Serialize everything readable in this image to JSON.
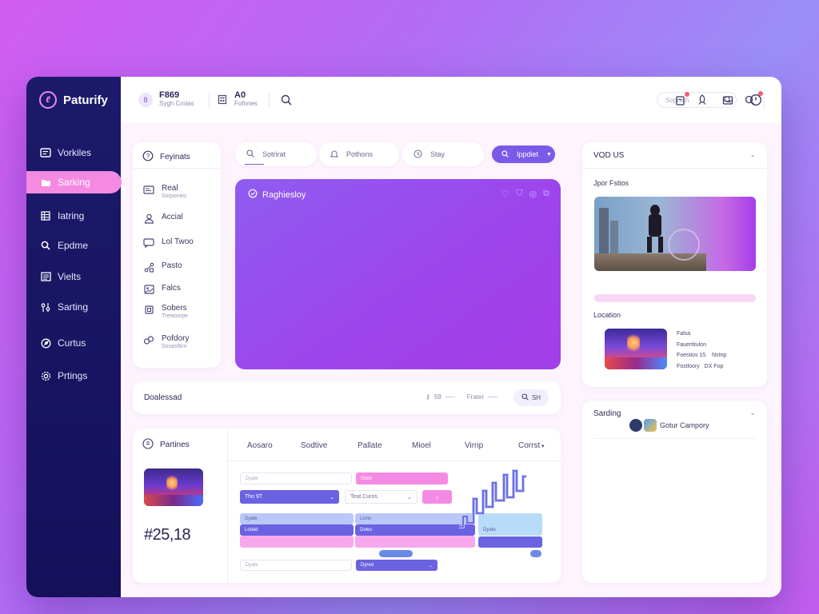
{
  "app": {
    "name": "Paturify"
  },
  "sidebar": {
    "items": [
      {
        "label": "Vorkiles",
        "icon": "dashboard-icon"
      },
      {
        "label": "Sarking",
        "icon": "folder-icon"
      },
      {
        "label": "Iatring",
        "icon": "list-icon"
      },
      {
        "label": "Epdme",
        "icon": "search-icon"
      },
      {
        "label": "Vielts",
        "icon": "views-icon"
      },
      {
        "label": "Sarting",
        "icon": "settings-sliders-icon"
      },
      {
        "label": "Curtus",
        "icon": "compass-icon"
      },
      {
        "label": "Prtings",
        "icon": "gear-icon"
      }
    ]
  },
  "topbar": {
    "stat1": {
      "title": "F869",
      "sub": "Sygh Crolas",
      "badge": "8"
    },
    "stat2": {
      "title": "A0",
      "sub": "Fofnnes"
    },
    "search_placeholder": "Soprvch"
  },
  "features": {
    "title": "Feyinats",
    "items": [
      {
        "label": "Real",
        "sub": "Sorponies"
      },
      {
        "label": "Accial",
        "sub": ""
      },
      {
        "label": "Lol Twoo",
        "sub": ""
      },
      {
        "label": "Pasto",
        "sub": ""
      },
      {
        "label": "Falcs",
        "sub": ""
      },
      {
        "label": "Sobers",
        "sub": "Trewoorpe"
      },
      {
        "label": "Pofdory",
        "sub": "Sosastbrn"
      }
    ]
  },
  "tabs": [
    {
      "label": "Sotrirat"
    },
    {
      "label": "Pothons"
    },
    {
      "label": "Stay"
    },
    {
      "label": "Ippdiet"
    }
  ],
  "hero": {
    "title": "Raghiesloy"
  },
  "download": {
    "title": "Doalessad",
    "meta1": "59",
    "meta2": "Frater",
    "action": "SH"
  },
  "partines": {
    "title": "Partines",
    "columns": [
      "Aosaro",
      "Sodtive",
      "Pallate",
      "Mioel",
      "Virrip",
      "Corrst"
    ],
    "amount": "#25,18",
    "form": {
      "f1": "Dyate",
      "f2": "Dloto",
      "f3": "Tho 9T",
      "f4": "Teat Curos",
      "f5": "Dyate",
      "f6": "Lotald",
      "f7": "Doles",
      "f8": "Lisnn",
      "f9": "Dyate",
      "f10": "Dyred"
    }
  },
  "right": {
    "panel_title": "VOD US",
    "section1": "Jpor Fstios",
    "section2": "Location",
    "loc_lines": [
      "Falsa",
      "Fauertitulon",
      "Foestios 15.",
      "Fostloory"
    ],
    "loc_values": [
      "",
      "",
      "Nstnp",
      "DX Fop"
    ],
    "sarding": {
      "title": "Sarding",
      "item": "Gotur Campory"
    }
  },
  "colors": {
    "accent": "#7a5ae8",
    "pink": "#f48ae2",
    "sidebar": "#1d1a6b"
  }
}
